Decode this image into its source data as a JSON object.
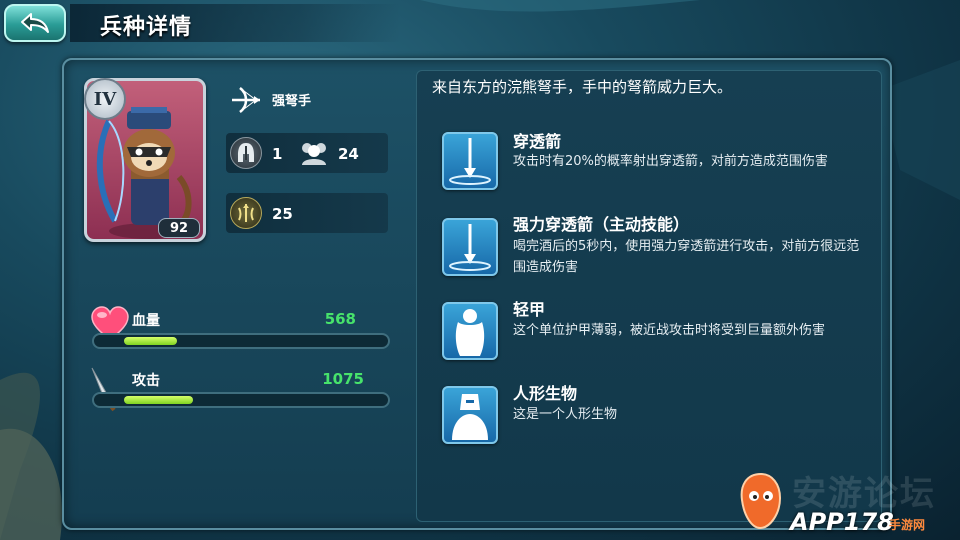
{
  "header": {
    "title": "兵种详情",
    "back_icon": "back-arrow-icon"
  },
  "unit": {
    "rank": "IV",
    "level": "92",
    "type_label": "强弩手",
    "type_icon": "crossbow-icon",
    "armor_icon": "helmet-icon",
    "armor_value": "1",
    "population_icon": "population-icon",
    "population_value": "24",
    "speed_icon": "speed-icon",
    "speed_value": "25"
  },
  "stats": {
    "hp": {
      "label": "血量",
      "value": "568",
      "fill": 0.2,
      "icon": "heart-icon"
    },
    "attack": {
      "label": "攻击",
      "value": "1075",
      "fill": 0.26,
      "icon": "sword-icon"
    }
  },
  "description": "来自东方的浣熊弩手，手中的弩箭威力巨大。",
  "skills": [
    {
      "name": "穿透箭",
      "desc": "攻击时有20%的概率射出穿透箭，对前方造成范围伤害",
      "icon": "piercing-arrow-icon"
    },
    {
      "name": "强力穿透箭（主动技能）",
      "desc": "喝完酒后的5秒内，使用强力穿透箭进行攻击，对前方很远范围造成伤害",
      "icon": "piercing-arrow-icon"
    },
    {
      "name": "轻甲",
      "desc": "这个单位护甲薄弱，被近战攻击时将受到巨量额外伤害",
      "icon": "cloak-icon"
    },
    {
      "name": "人形生物",
      "desc": "这是一个人形生物",
      "icon": "humanoid-icon"
    }
  ],
  "watermark": {
    "site": "APP178",
    "site_sub": "手游网",
    "faint": "安游论坛"
  },
  "colors": {
    "accent": "#47e36b",
    "bar_fill": "#a8ec3c",
    "skill_icon": "#2a8cc8",
    "card": "#b24c6e"
  }
}
